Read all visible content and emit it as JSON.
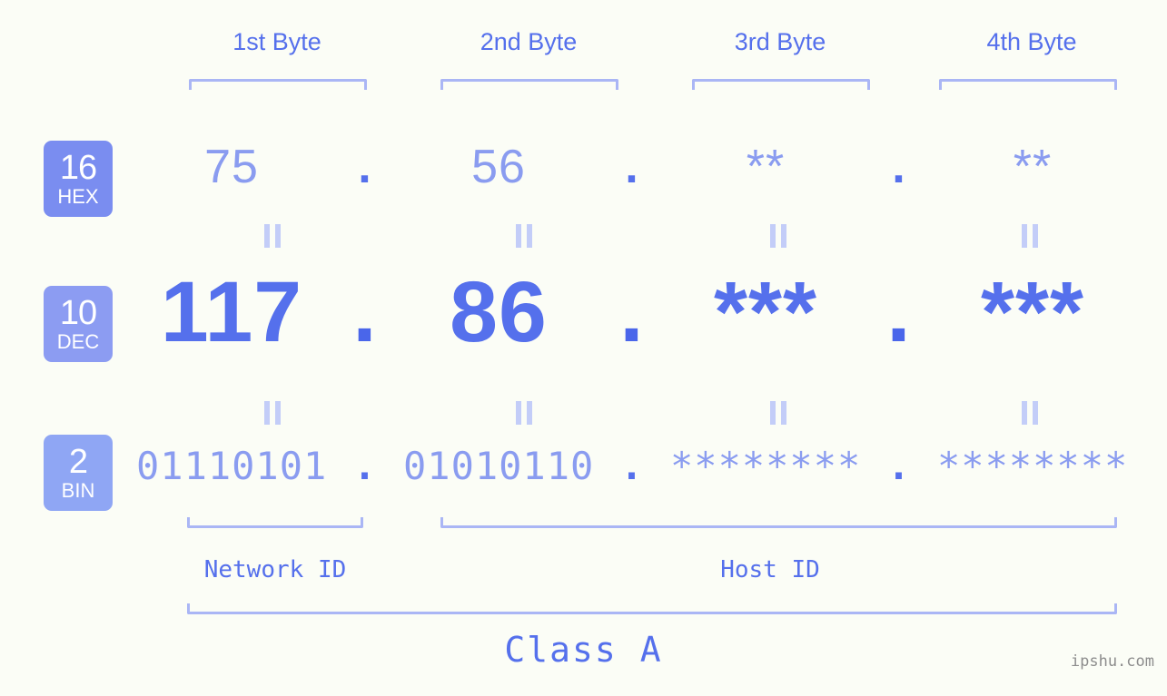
{
  "background": "#fbfdf6",
  "colors": {
    "primary": "#5570ec",
    "light": "#8a9cf0",
    "bracket": "#aab6f5",
    "connector": "#c3cdf8",
    "badge_hex": "#7a8df0",
    "badge_dec": "#8c9cf2",
    "badge_bin": "#8fa6f4",
    "watermark": "#8d8d8d"
  },
  "header": {
    "byte_labels": [
      "1st Byte",
      "2nd Byte",
      "3rd Byte",
      "4th Byte"
    ]
  },
  "bases": [
    {
      "number": "16",
      "name": "HEX"
    },
    {
      "number": "10",
      "name": "DEC"
    },
    {
      "number": "2",
      "name": "BIN"
    }
  ],
  "rows": {
    "hex": {
      "base_number": "16",
      "base_name": "HEX",
      "bytes": [
        "75",
        "56",
        "**",
        "**"
      ],
      "separator": "."
    },
    "dec": {
      "base_number": "10",
      "base_name": "DEC",
      "bytes": [
        "117",
        "86",
        "***",
        "***"
      ],
      "separator": "."
    },
    "bin": {
      "base_number": "2",
      "base_name": "BIN",
      "bytes": [
        "01110101",
        "01010110",
        "********",
        "********"
      ],
      "separator": "."
    }
  },
  "connectors": {
    "symbol": "||",
    "count_per_row": 4
  },
  "footer": {
    "network_id_label": "Network ID",
    "host_id_label": "Host ID",
    "class_label": "Class A",
    "watermark": "ipshu.com"
  }
}
